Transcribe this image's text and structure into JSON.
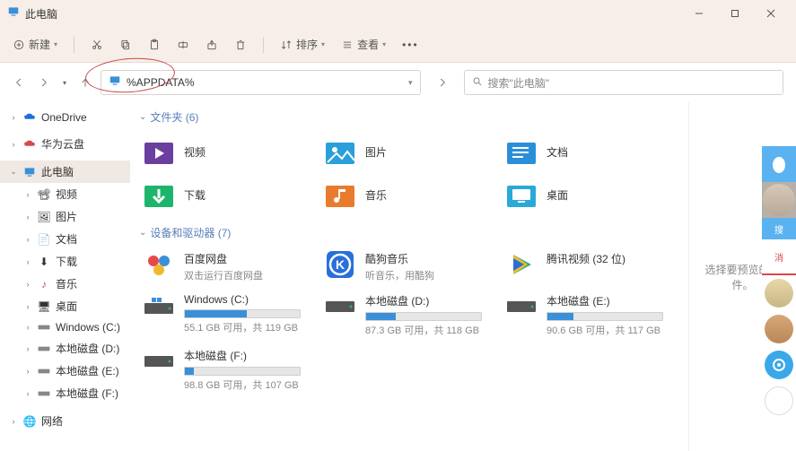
{
  "titlebar": {
    "title": "此电脑"
  },
  "toolbar": {
    "new_label": "新建",
    "sort_label": "排序",
    "view_label": "查看"
  },
  "address": {
    "value": "%APPDATA%"
  },
  "search": {
    "placeholder": "搜索\"此电脑\""
  },
  "tree": {
    "onedrive": "OneDrive",
    "huawei": "华为云盘",
    "thispc": "此电脑",
    "videos": "视频",
    "pictures": "图片",
    "documents": "文档",
    "downloads": "下载",
    "music": "音乐",
    "desktop": "桌面",
    "winc": "Windows (C:)",
    "diskd": "本地磁盘 (D:)",
    "diske": "本地磁盘 (E:)",
    "diskf": "本地磁盘 (F:)",
    "network": "网络"
  },
  "sections": {
    "folders": "文件夹 (6)",
    "drives": "设备和驱动器 (7)"
  },
  "folders": {
    "videos": "视频",
    "pictures": "图片",
    "documents": "文档",
    "downloads": "下载",
    "music": "音乐",
    "desktop": "桌面"
  },
  "drives": {
    "baidu": {
      "name": "百度网盘",
      "sub": "双击运行百度网盘"
    },
    "kugou": {
      "name": "酷狗音乐",
      "sub": "听音乐，用酷狗"
    },
    "tencent": {
      "name": "腾讯视频 (32 位)",
      "sub": ""
    },
    "winc": {
      "name": "Windows (C:)",
      "sub": "55.1 GB 可用，共 119 GB",
      "fill": 54
    },
    "diskd": {
      "name": "本地磁盘 (D:)",
      "sub": "87.3 GB 可用，共 118 GB",
      "fill": 26
    },
    "diske": {
      "name": "本地磁盘 (E:)",
      "sub": "90.6 GB 可用，共 117 GB",
      "fill": 23
    },
    "diskf": {
      "name": "本地磁盘 (F:)",
      "sub": "98.8 GB 可用，共 107 GB",
      "fill": 8
    }
  },
  "preview": {
    "text": "选择要预览的文件。"
  },
  "dock": {
    "search_label": "搜",
    "msg_label": "消"
  }
}
